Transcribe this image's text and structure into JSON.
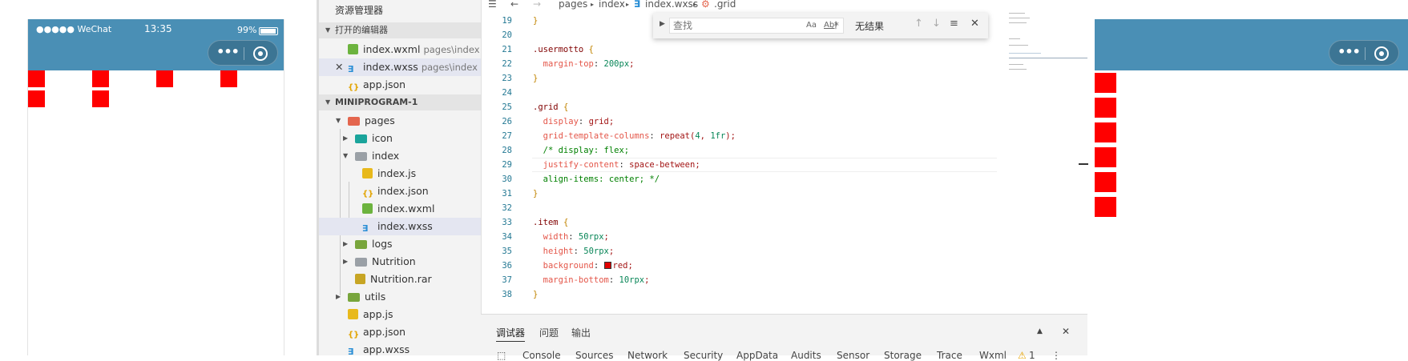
{
  "simulator": {
    "carrier": "●●●●● WeChat",
    "time": "13:35",
    "battery": "99%"
  },
  "explorer": {
    "title": "资源管理器",
    "open_editors_header": "打开的编辑器",
    "open_editors": [
      {
        "name": "index.wxml",
        "desc": "pages\\index"
      },
      {
        "name": "index.wxss",
        "desc": "pages\\index"
      },
      {
        "name": "app.json",
        "desc": ""
      }
    ],
    "project_header": "MINIPROGRAM-1",
    "tree": [
      {
        "name": "pages"
      },
      {
        "name": "icon"
      },
      {
        "name": "index"
      },
      {
        "name": "index.js"
      },
      {
        "name": "index.json"
      },
      {
        "name": "index.wxml"
      },
      {
        "name": "index.wxss"
      },
      {
        "name": "logs"
      },
      {
        "name": "Nutrition"
      },
      {
        "name": "Nutrition.rar"
      },
      {
        "name": "utils"
      },
      {
        "name": "app.js"
      },
      {
        "name": "app.json"
      },
      {
        "name": "app.wxss"
      }
    ]
  },
  "editor": {
    "breadcrumb": [
      "pages",
      "index",
      "index.wxss",
      ".grid"
    ],
    "lines": [
      {
        "n": "19",
        "t": "}"
      },
      {
        "n": "20",
        "t": ""
      },
      {
        "n": "21",
        "t": ".usermotto {"
      },
      {
        "n": "22",
        "t": "  margin-top: 200px;"
      },
      {
        "n": "23",
        "t": "}"
      },
      {
        "n": "24",
        "t": ""
      },
      {
        "n": "25",
        "t": ".grid {"
      },
      {
        "n": "26",
        "t": "  display: grid;"
      },
      {
        "n": "27",
        "t": "  grid-template-columns: repeat(4, 1fr);"
      },
      {
        "n": "28",
        "t": "  /* display: flex;"
      },
      {
        "n": "29",
        "t": "  justify-content: space-between;"
      },
      {
        "n": "30",
        "t": "  align-items: center; */"
      },
      {
        "n": "31",
        "t": "}"
      },
      {
        "n": "32",
        "t": ""
      },
      {
        "n": "33",
        "t": ".item {"
      },
      {
        "n": "34",
        "t": "  width: 50rpx;"
      },
      {
        "n": "35",
        "t": "  height: 50rpx;"
      },
      {
        "n": "36",
        "t": "  background: red;"
      },
      {
        "n": "37",
        "t": "  margin-bottom: 10rpx;"
      },
      {
        "n": "38",
        "t": "}"
      }
    ]
  },
  "find": {
    "placeholder": "查找",
    "match_case": "Aa",
    "whole_word": "Ab|",
    "regex": ".*",
    "result": "无结果"
  },
  "panel": {
    "tabs": [
      "调试器",
      "问题",
      "输出"
    ],
    "devtools_tabs": [
      "Console",
      "Sources",
      "Network",
      "Security",
      "AppData",
      "Audits",
      "Sensor",
      "Storage",
      "Trace",
      "Wxml"
    ],
    "warning_count": "1"
  },
  "colors": {
    "navbar": "#4a8fb5",
    "square": "#ff0000",
    "explorer_bg": "#f3f3f3"
  }
}
